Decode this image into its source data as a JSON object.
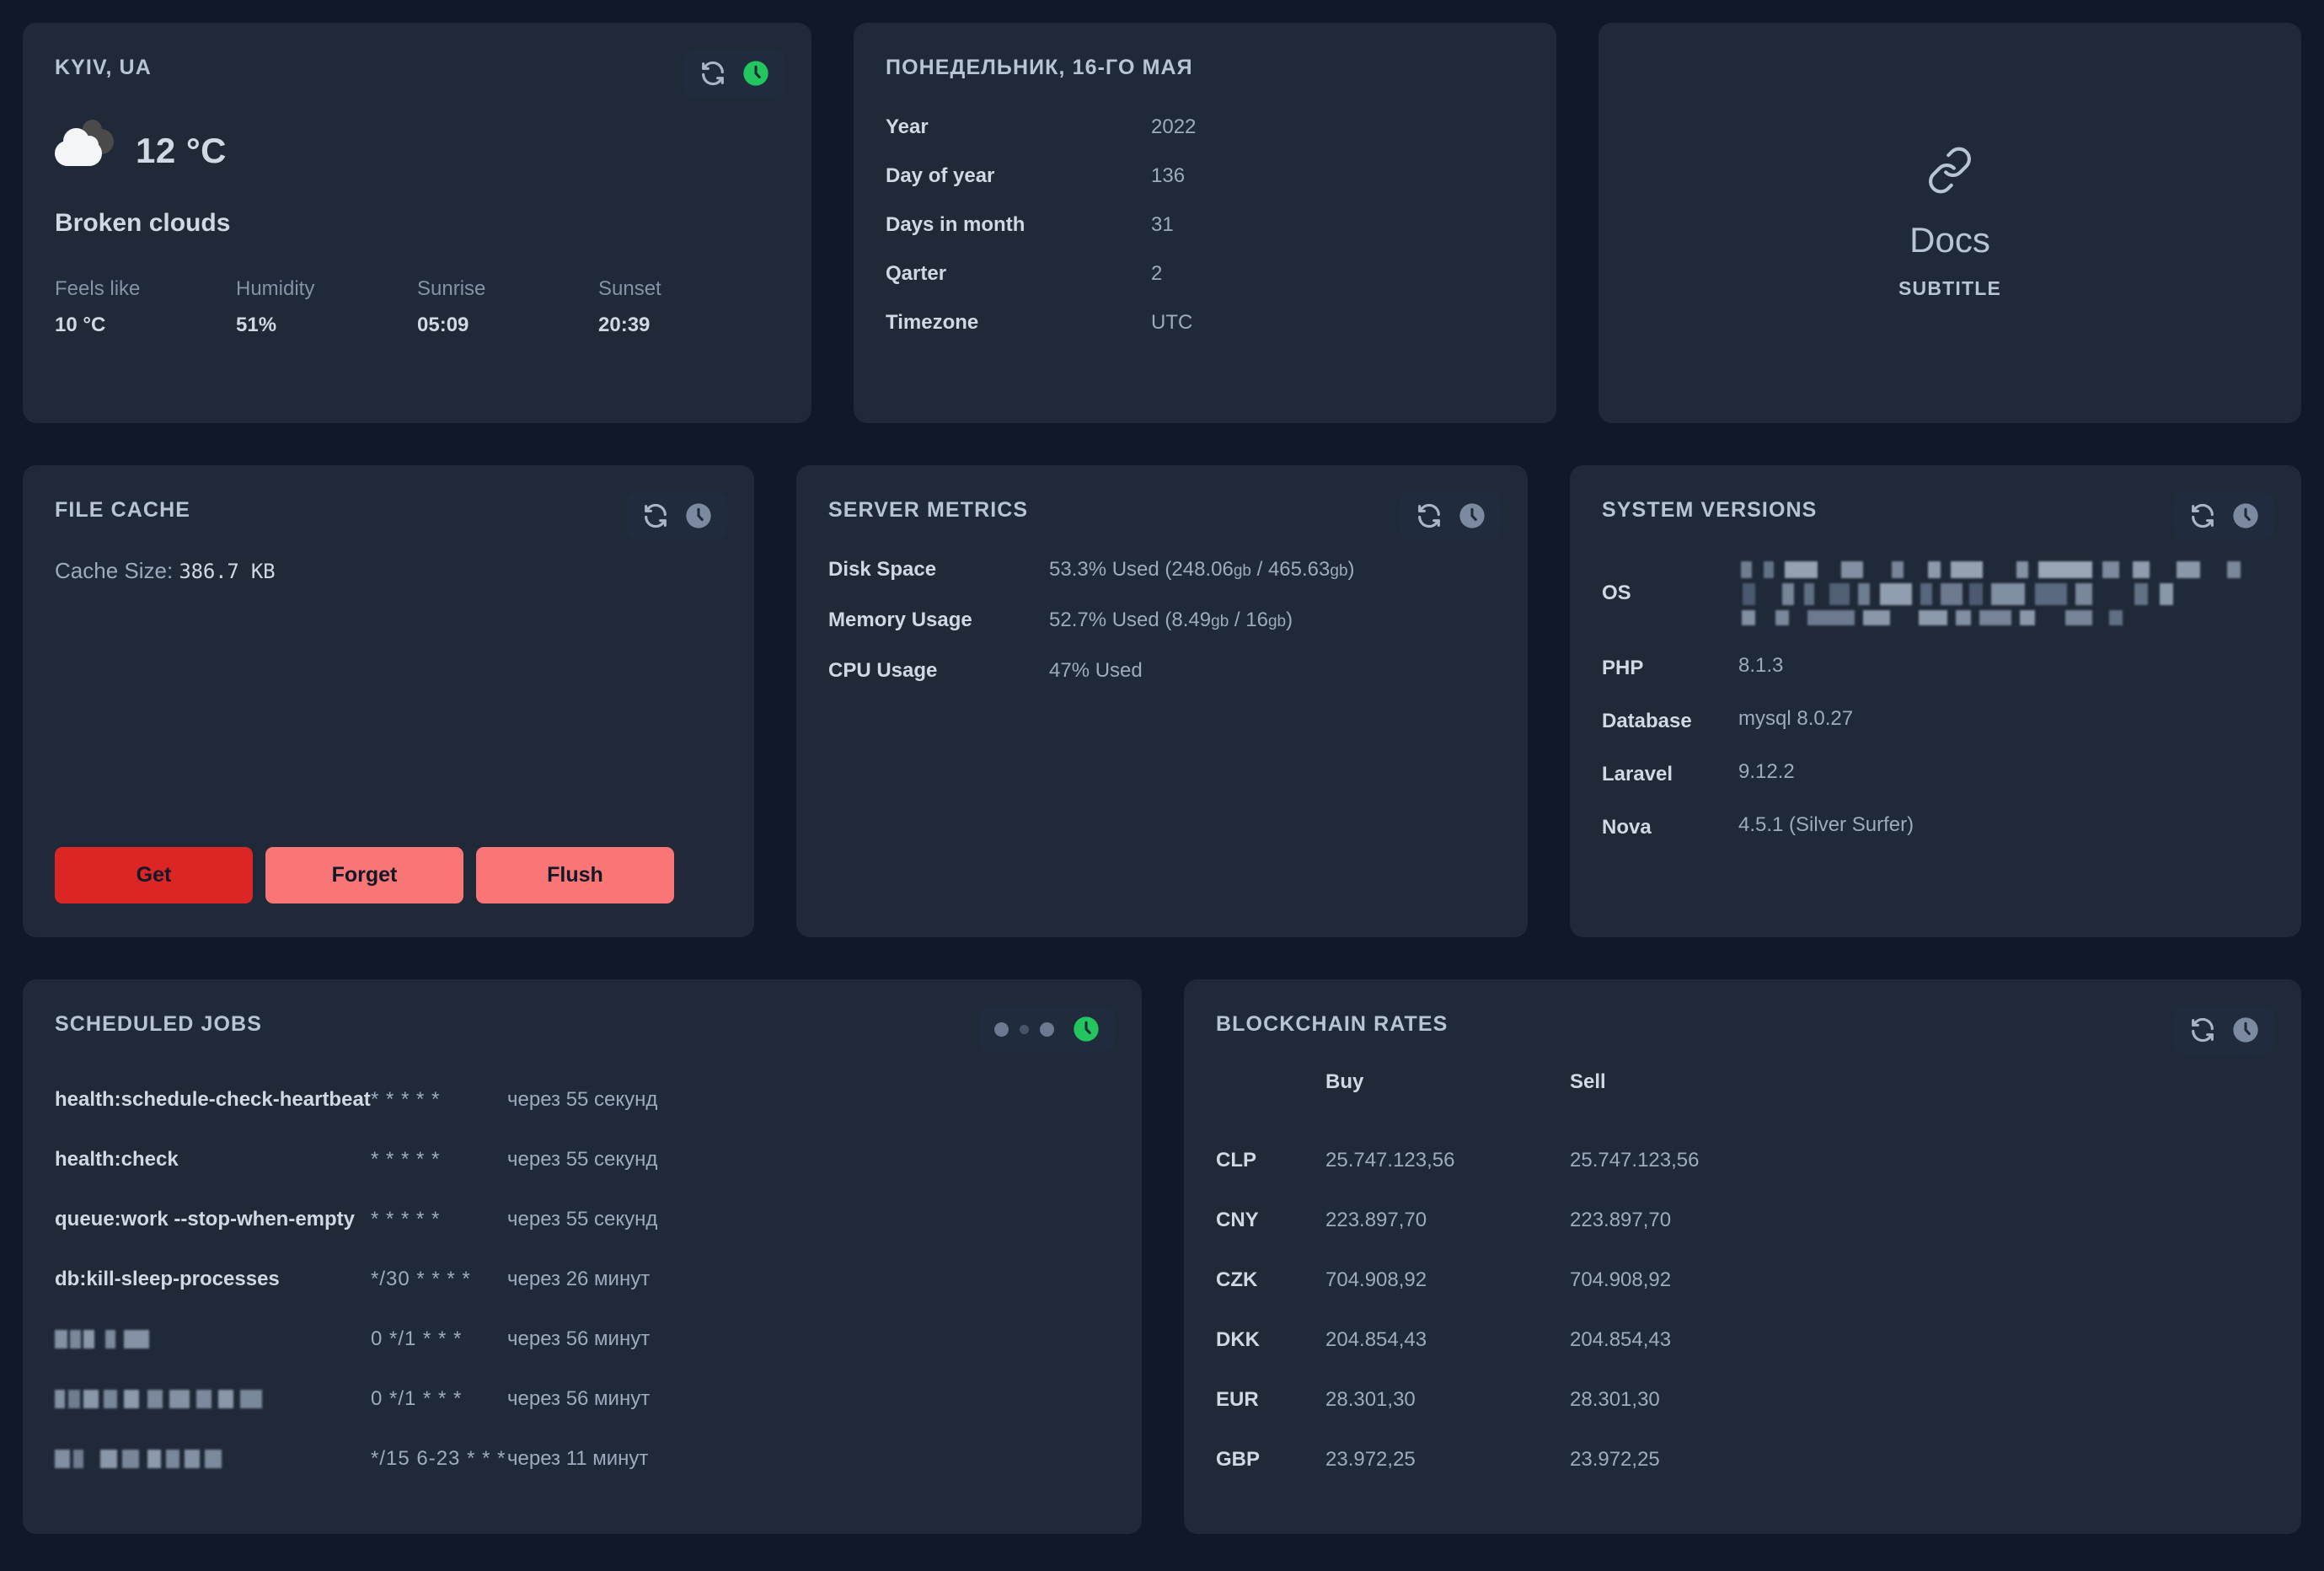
{
  "colors": {
    "page_bg": "#111827",
    "card_bg": "#1f2937",
    "accent_green": "#22c55e",
    "btn_primary": "#dc2626",
    "btn_soft": "#fa7575"
  },
  "weather": {
    "title": "KYIV, UA",
    "refresh_icon": "refresh-icon",
    "status_icon": "clock-icon",
    "condition_icon": "broken-clouds-icon",
    "temperature": "12 °C",
    "description": "Broken clouds",
    "stats": [
      {
        "label": "Feels like",
        "value": "10 °C"
      },
      {
        "label": "Humidity",
        "value": "51%"
      },
      {
        "label": "Sunrise",
        "value": "05:09"
      },
      {
        "label": "Sunset",
        "value": "20:39"
      }
    ]
  },
  "date_card": {
    "title": "ПОНЕДЕЛЬНИК, 16-ГО МАЯ",
    "rows": [
      {
        "key": "Year",
        "value": "2022"
      },
      {
        "key": "Day of year",
        "value": "136"
      },
      {
        "key": "Days in month",
        "value": "31"
      },
      {
        "key": "Qarter",
        "value": "2"
      },
      {
        "key": "Timezone",
        "value": "UTC"
      }
    ]
  },
  "docs_card": {
    "icon": "link-icon",
    "title": "Docs",
    "subtitle": "SUBTITLE"
  },
  "file_cache": {
    "title": "FILE CACHE",
    "refresh_icon": "refresh-icon",
    "status_icon": "clock-icon",
    "cache_size_label": "Cache Size:",
    "cache_size_value": "386.7  KB",
    "buttons": [
      {
        "label": "Get",
        "style": "primary"
      },
      {
        "label": "Forget",
        "style": "soft"
      },
      {
        "label": "Flush",
        "style": "soft"
      }
    ]
  },
  "server_metrics": {
    "title": "SERVER METRICS",
    "refresh_icon": "refresh-icon",
    "status_icon": "clock-icon",
    "rows": [
      {
        "key": "Disk Space",
        "value": "53.3% Used (248.06",
        "unit1": "gb",
        "mid": " / 465.63",
        "unit2": "gb",
        "tail": ")"
      },
      {
        "key": "Memory Usage",
        "value": "52.7% Used (8.49",
        "unit1": "gb",
        "mid": " / 16",
        "unit2": "gb",
        "tail": ")"
      },
      {
        "key": "CPU Usage",
        "value": "47% Used",
        "unit1": "",
        "mid": "",
        "unit2": "",
        "tail": ""
      }
    ]
  },
  "system_versions": {
    "title": "SYSTEM VERSIONS",
    "refresh_icon": "refresh-icon",
    "status_icon": "clock-icon",
    "os_key": "OS",
    "os_value_redacted": true,
    "rows": [
      {
        "key": "PHP",
        "value": "8.1.3"
      },
      {
        "key": "Database",
        "value": "mysql 8.0.27"
      },
      {
        "key": "Laravel",
        "value": "9.12.2"
      },
      {
        "key": "Nova",
        "value": "4.5.1 (Silver Surfer)"
      }
    ]
  },
  "scheduled_jobs": {
    "title": "SCHEDULED JOBS",
    "loading_dots": 3,
    "status_icon": "clock-icon",
    "rows": [
      {
        "name": "health:schedule-check-heartbeat",
        "redacted": false,
        "cron": "* * * * *",
        "next": "через 55 секунд"
      },
      {
        "name": "health:check",
        "redacted": false,
        "cron": "* * * * *",
        "next": "через 55 секунд"
      },
      {
        "name": "queue:work --stop-when-empty",
        "redacted": false,
        "cron": "* * * * *",
        "next": "через 55 секунд"
      },
      {
        "name": "db:kill-sleep-processes",
        "redacted": false,
        "cron": "*/30 * * * *",
        "next": "через 26 минут"
      },
      {
        "name": "",
        "redacted": true,
        "cron": "0 */1 * * *",
        "next": "через 56 минут"
      },
      {
        "name": "",
        "redacted": true,
        "cron": "0 */1 * * *",
        "next": "через 56 минут"
      },
      {
        "name": "",
        "redacted": true,
        "cron": "*/15 6-23 * * *",
        "next": "через 11 минут"
      }
    ]
  },
  "blockchain_rates": {
    "title": "BLOCKCHAIN RATES",
    "refresh_icon": "refresh-icon",
    "status_icon": "clock-icon",
    "columns": [
      "",
      "Buy",
      "Sell"
    ],
    "rows": [
      {
        "currency": "CLP",
        "buy": "25.747.123,56",
        "sell": "25.747.123,56"
      },
      {
        "currency": "CNY",
        "buy": "223.897,70",
        "sell": "223.897,70"
      },
      {
        "currency": "CZK",
        "buy": "704.908,92",
        "sell": "704.908,92"
      },
      {
        "currency": "DKK",
        "buy": "204.854,43",
        "sell": "204.854,43"
      },
      {
        "currency": "EUR",
        "buy": "28.301,30",
        "sell": "28.301,30"
      },
      {
        "currency": "GBP",
        "buy": "23.972,25",
        "sell": "23.972,25"
      }
    ]
  }
}
